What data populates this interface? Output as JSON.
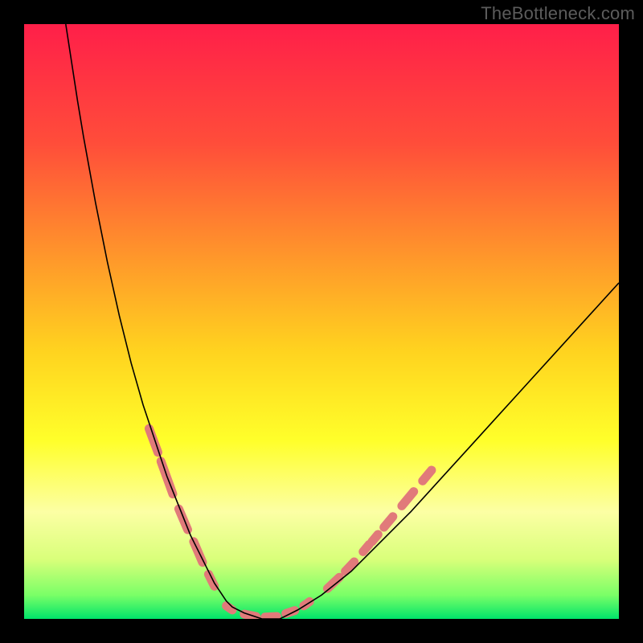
{
  "watermark": "TheBottleneck.com",
  "chart_data": {
    "type": "line",
    "title": "",
    "xlabel": "",
    "ylabel": "",
    "xlim": [
      0,
      100
    ],
    "ylim": [
      0,
      100
    ],
    "grid": false,
    "legend": false,
    "background_gradient": {
      "stops": [
        {
          "offset": 0.0,
          "color": "#ff1f49"
        },
        {
          "offset": 0.2,
          "color": "#ff4d3a"
        },
        {
          "offset": 0.4,
          "color": "#ff9a2a"
        },
        {
          "offset": 0.55,
          "color": "#ffd31f"
        },
        {
          "offset": 0.7,
          "color": "#ffff2a"
        },
        {
          "offset": 0.82,
          "color": "#fcffa4"
        },
        {
          "offset": 0.9,
          "color": "#d9ff7a"
        },
        {
          "offset": 0.96,
          "color": "#7aff67"
        },
        {
          "offset": 1.0,
          "color": "#00e46a"
        }
      ]
    },
    "series": [
      {
        "name": "bottleneck-curve",
        "color": "#000000",
        "width": 1.6,
        "x": [
          7,
          8,
          9,
          10,
          11,
          12,
          13,
          14,
          15,
          16,
          17,
          18,
          19,
          20,
          21,
          22,
          23,
          24,
          25,
          26,
          27,
          28,
          29,
          30,
          31,
          32,
          33,
          34,
          35,
          37,
          40,
          43,
          46,
          50,
          55,
          60,
          65,
          70,
          75,
          80,
          85,
          90,
          95,
          100
        ],
        "y": [
          100,
          93.5,
          87,
          81,
          75.5,
          70,
          65,
          60,
          55.5,
          51,
          47,
          43,
          39.5,
          36,
          33,
          30,
          27,
          24,
          21.5,
          19,
          16.5,
          14,
          12,
          10,
          8,
          6,
          4.5,
          3,
          2,
          1,
          0,
          0,
          1.5,
          4,
          8,
          13,
          18,
          23.5,
          29,
          34.5,
          40,
          45.5,
          51,
          56.5
        ]
      }
    ],
    "markers": {
      "name": "highlighted-segments",
      "color": "#e17a7a",
      "width": 11,
      "linecap": "round",
      "segments": [
        {
          "x1": 21.0,
          "y1": 32.0,
          "x2": 22.5,
          "y2": 28.0
        },
        {
          "x1": 23.0,
          "y1": 26.5,
          "x2": 25.0,
          "y2": 21.0
        },
        {
          "x1": 26.0,
          "y1": 18.5,
          "x2": 27.5,
          "y2": 15.0
        },
        {
          "x1": 28.5,
          "y1": 13.0,
          "x2": 30.0,
          "y2": 9.5
        },
        {
          "x1": 31.0,
          "y1": 7.5,
          "x2": 32.0,
          "y2": 5.5
        },
        {
          "x1": 34.0,
          "y1": 2.2,
          "x2": 35.0,
          "y2": 1.5
        },
        {
          "x1": 37.0,
          "y1": 0.8,
          "x2": 39.0,
          "y2": 0.4
        },
        {
          "x1": 40.5,
          "y1": 0.3,
          "x2": 42.5,
          "y2": 0.4
        },
        {
          "x1": 44.0,
          "y1": 0.9,
          "x2": 45.5,
          "y2": 1.4
        },
        {
          "x1": 47.0,
          "y1": 2.2,
          "x2": 48.0,
          "y2": 2.9
        },
        {
          "x1": 51.0,
          "y1": 5.1,
          "x2": 53.0,
          "y2": 7.0
        },
        {
          "x1": 54.0,
          "y1": 8.0,
          "x2": 55.5,
          "y2": 9.6
        },
        {
          "x1": 57.0,
          "y1": 11.3,
          "x2": 58.0,
          "y2": 12.5
        },
        {
          "x1": 58.5,
          "y1": 13.0,
          "x2": 59.5,
          "y2": 14.2
        },
        {
          "x1": 60.5,
          "y1": 15.4,
          "x2": 62.0,
          "y2": 17.2
        },
        {
          "x1": 63.5,
          "y1": 19.0,
          "x2": 65.5,
          "y2": 21.4
        },
        {
          "x1": 67.0,
          "y1": 23.2,
          "x2": 68.5,
          "y2": 25.0
        }
      ]
    }
  }
}
